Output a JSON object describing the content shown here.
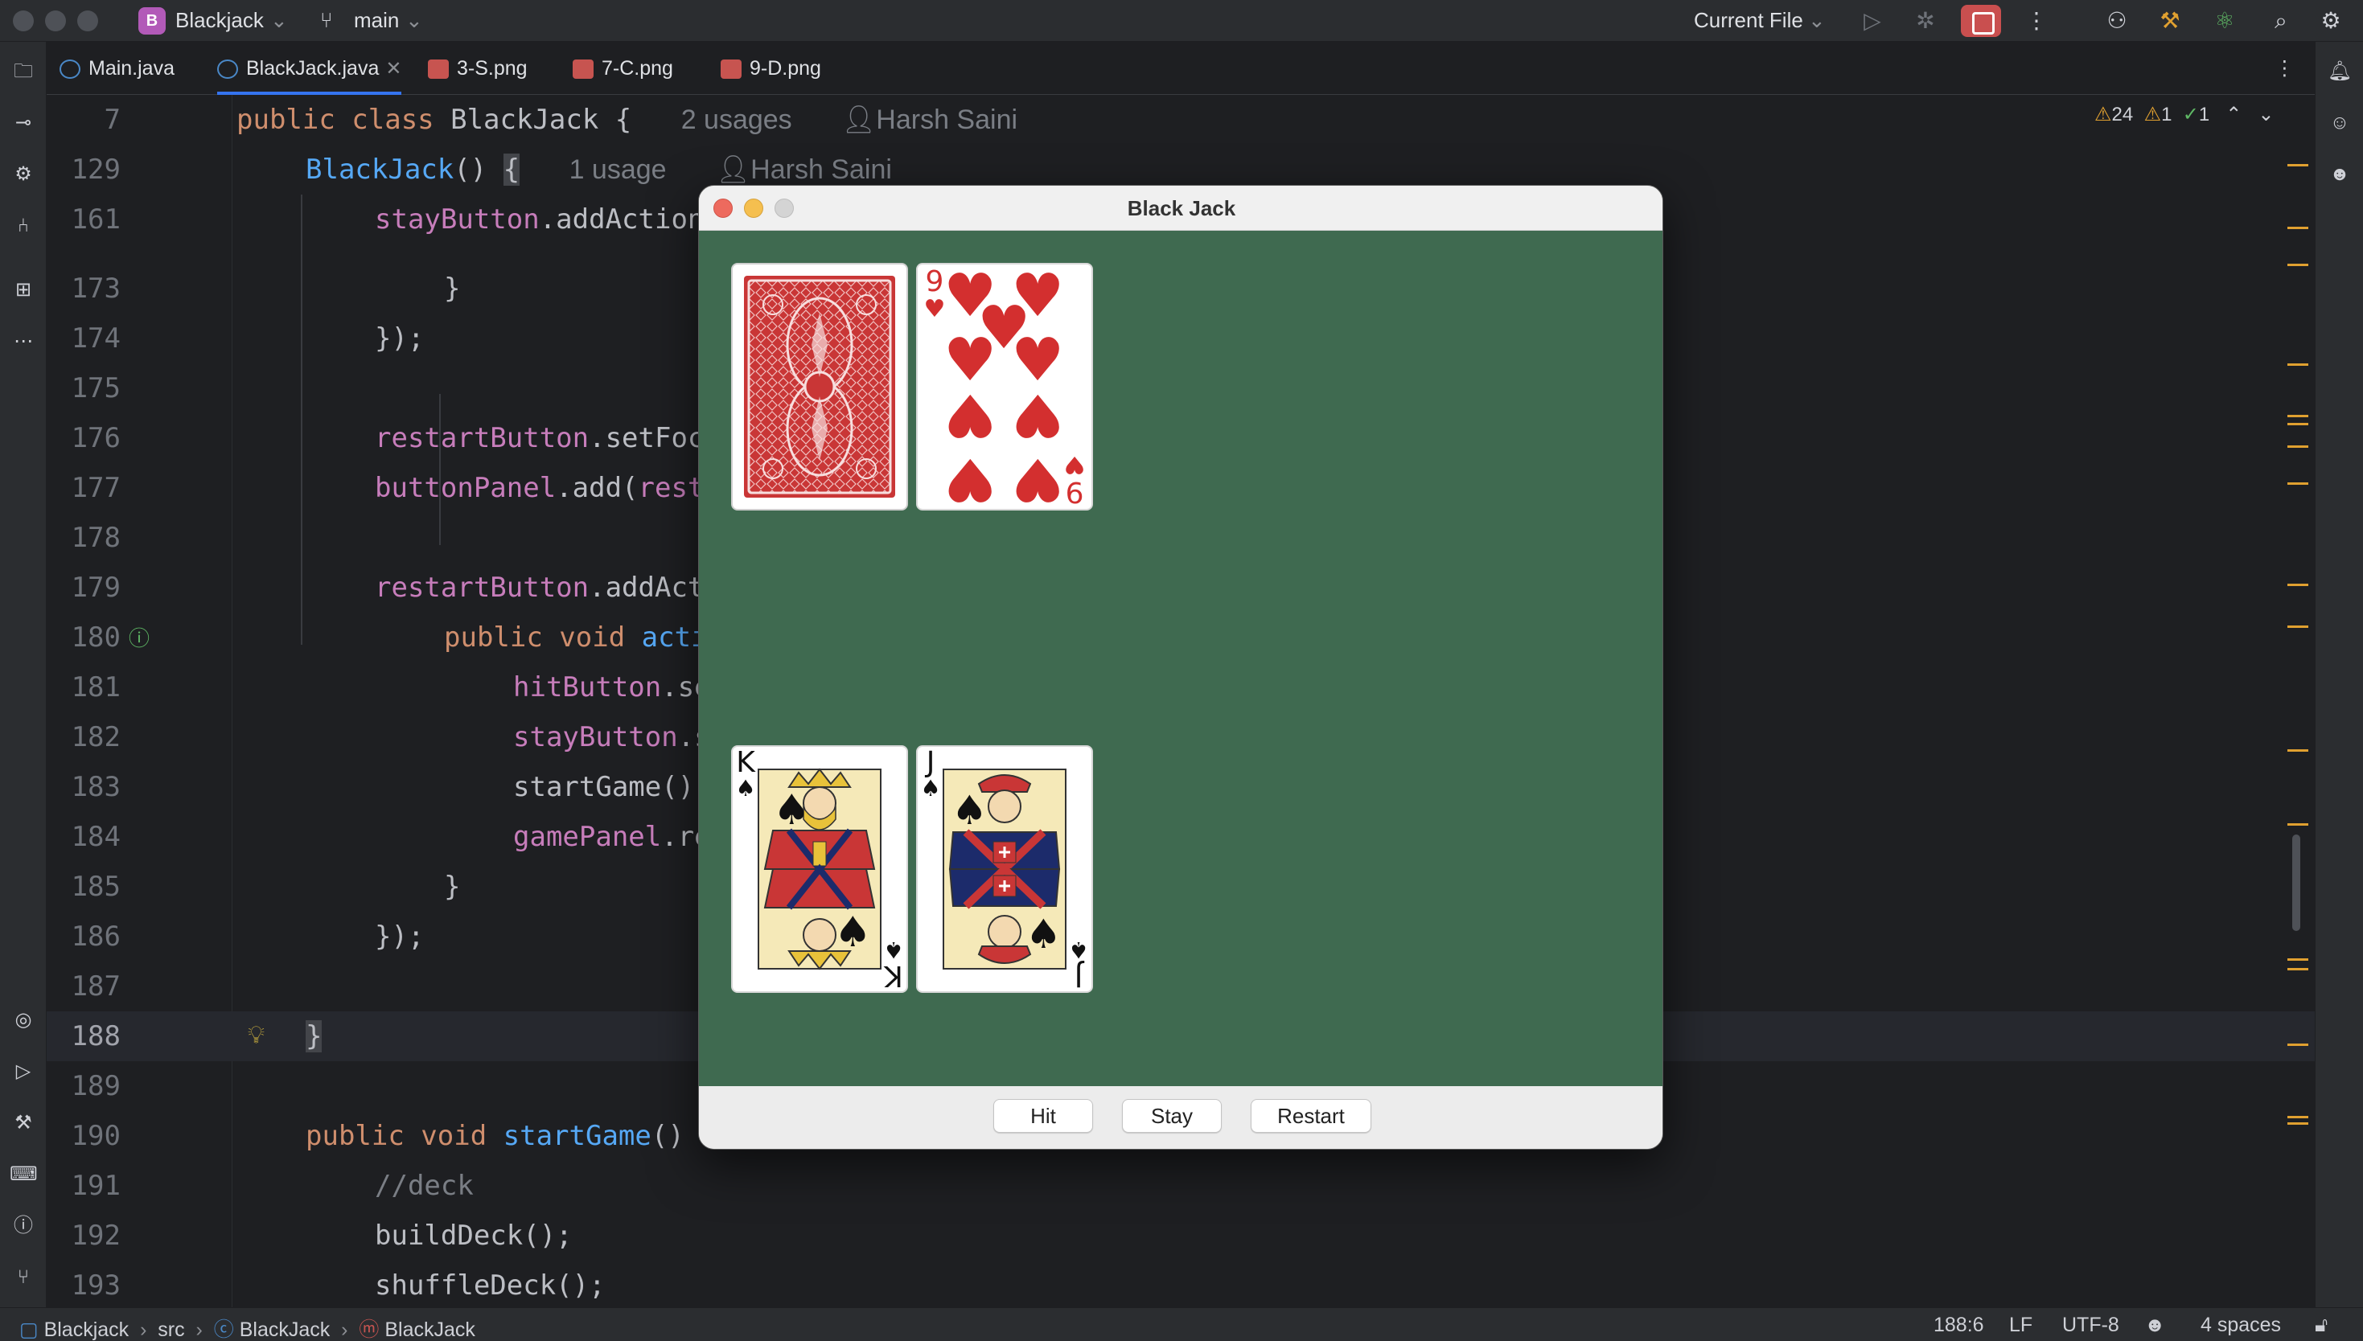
{
  "titlebar": {
    "project_badge": "B",
    "project_name": "Blackjack",
    "branch": "main",
    "run_config": "Current File"
  },
  "tabs": [
    {
      "label": "Main.java",
      "close": ""
    },
    {
      "label": "BlackJack.java",
      "close": "✕"
    },
    {
      "label": "3-S.png",
      "close": ""
    },
    {
      "label": "7-C.png",
      "close": ""
    },
    {
      "label": "9-D.png",
      "close": ""
    }
  ],
  "inspections": {
    "warnings": "24",
    "weak_warnings": "1",
    "ok": "1"
  },
  "editor": {
    "sticky1": {
      "num": "7",
      "hint_usages": "2 usages",
      "hint_author": "Harsh Saini"
    },
    "sticky2": {
      "num": "129",
      "hint_usages": "1 usage",
      "hint_author": "Harsh Saini"
    },
    "sticky3": {
      "num": "161"
    },
    "lines": [
      {
        "num": "173"
      },
      {
        "num": "174"
      },
      {
        "num": "175"
      },
      {
        "num": "176"
      },
      {
        "num": "177"
      },
      {
        "num": "178"
      },
      {
        "num": "179"
      },
      {
        "num": "180"
      },
      {
        "num": "181"
      },
      {
        "num": "182"
      },
      {
        "num": "183"
      },
      {
        "num": "184"
      },
      {
        "num": "185"
      },
      {
        "num": "186"
      },
      {
        "num": "187"
      },
      {
        "num": "188"
      },
      {
        "num": "189"
      },
      {
        "num": "190"
      },
      {
        "num": "191"
      },
      {
        "num": "192"
      },
      {
        "num": "193"
      }
    ]
  },
  "game_window": {
    "title": "Black Jack",
    "buttons": {
      "hit": "Hit",
      "stay": "Stay",
      "restart": "Restart"
    },
    "dealer_cards": [
      {
        "card": "BACK"
      },
      {
        "rank": "9",
        "suit": "♥"
      }
    ],
    "player_cards": [
      {
        "rank": "K",
        "suit": "♠"
      },
      {
        "rank": "J",
        "suit": "♠"
      }
    ]
  },
  "statusbar": {
    "crumbs": [
      "Blackjack",
      "src",
      "BlackJack",
      "BlackJack"
    ],
    "position": "188:6",
    "line_sep": "LF",
    "encoding": "UTF-8",
    "indent": "4 spaces"
  },
  "colors": {
    "table_green": "#3f6a50",
    "ide_bg": "#1e1f22",
    "keyword": "#cf8e6d",
    "function": "#56a8f5",
    "field": "#c77dbb"
  }
}
